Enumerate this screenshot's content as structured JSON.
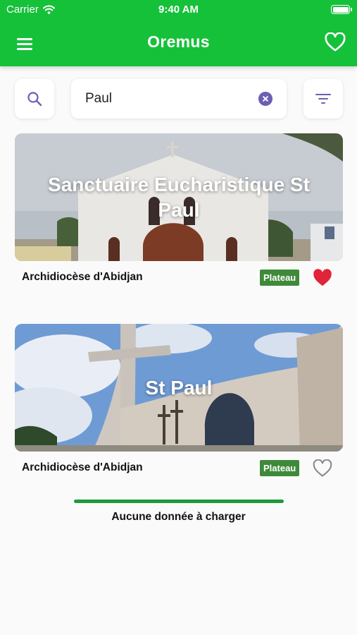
{
  "status_bar": {
    "carrier": "Carrier",
    "time": "9:40 AM"
  },
  "header": {
    "title": "Oremus",
    "icons": {
      "menu": "menu-icon",
      "favorites": "heart-outline-icon"
    }
  },
  "search": {
    "value": "Paul",
    "placeholder": "",
    "icons": {
      "search": "search-icon",
      "clear": "clear-icon",
      "filter": "filter-icon"
    }
  },
  "results": [
    {
      "title": "Sanctuaire Eucharistique St Paul",
      "diocese": "Archidiocèse d'Abidjan",
      "zone": "Plateau",
      "favorite": true
    },
    {
      "title": "St Paul",
      "diocese": "Archidiocèse d'Abidjan",
      "zone": "Plateau",
      "favorite": false
    }
  ],
  "footer": {
    "message": "Aucune donnée à charger"
  },
  "colors": {
    "brand_green": "#16c13a",
    "badge_green": "#3f8a3a",
    "icon_purple": "#6b5fb4",
    "heart_red": "#e0243a",
    "progress_green": "#1f9a3b"
  }
}
